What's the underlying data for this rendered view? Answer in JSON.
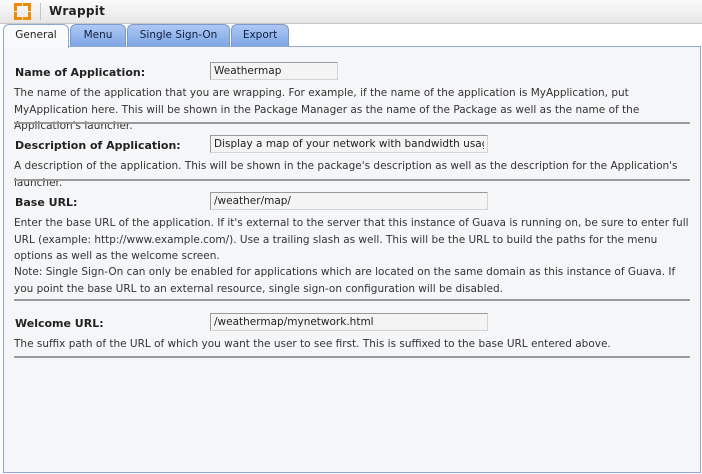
{
  "app": {
    "title": "Wrappit",
    "icon": "fullscreen-corners-icon",
    "accent_color": "#f08a00"
  },
  "tabs": [
    {
      "label": "General",
      "active": true
    },
    {
      "label": "Menu",
      "active": false
    },
    {
      "label": "Single Sign-On",
      "active": false
    },
    {
      "label": "Export",
      "active": false
    }
  ],
  "fields": {
    "name": {
      "label": "Name of Application:",
      "value": "Weathermap",
      "description": "The name of the application that you are wrapping. For example, if the name of the application is MyApplication, put MyApplication here. This will be shown in the Package Manager as the name of the Package as well as the name of the Application's launcher."
    },
    "description": {
      "label": "Description of Application:",
      "value": "Display a map of your network with bandwidth usage.",
      "description": "A description of the application. This will be shown in the package's description as well as the description for the Application's launcher."
    },
    "base_url": {
      "label": "Base URL:",
      "value": "/weather/map/",
      "description": "Enter the base URL of the application. If it's external to the server that this instance of Guava is running on, be sure to enter full URL (example: http://www.example.com/). Use a trailing slash as well. This will be the URL to build the paths for the menu options as well as the welcome screen.",
      "note": "Note: Single Sign-On can only be enabled for applications which are located on the same domain as this instance of Guava. If you point the base URL to an external resource, single sign-on configuration will be disabled."
    },
    "welcome_url": {
      "label": "Welcome URL:",
      "value": "/weathermap/mynetwork.html",
      "description": "The suffix path of the URL of which you want the user to see first. This is suffixed to the base URL entered above."
    }
  }
}
